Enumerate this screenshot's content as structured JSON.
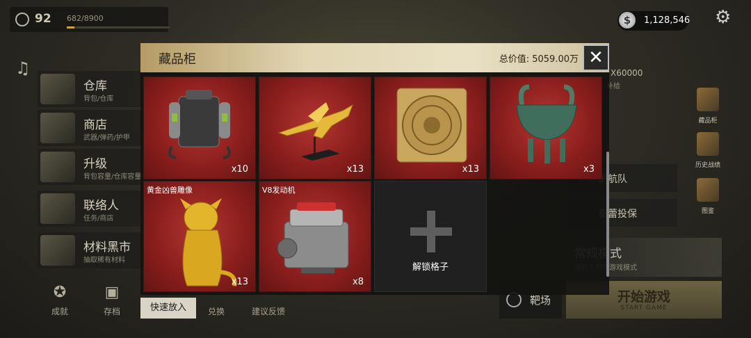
{
  "player": {
    "level": "92",
    "xp": "682/8900",
    "xp_progress": 0.077
  },
  "currency": {
    "amount": "1,128,546",
    "icon_glyph": "$"
  },
  "left_menu": [
    {
      "title": "仓库",
      "subtitle": "背包/仓库"
    },
    {
      "title": "商店",
      "subtitle": "武器/弹药/护甲"
    },
    {
      "title": "升级",
      "subtitle": "背包容量/仓库容量"
    },
    {
      "title": "联络人",
      "subtitle": "任务/商店"
    },
    {
      "title": "材料黑市",
      "subtitle": "抽取稀有材料"
    }
  ],
  "bottom_bar": [
    {
      "label": "成就",
      "icon": "medal-icon"
    },
    {
      "label": "存档",
      "icon": "save-icon"
    },
    {
      "label": "兑换",
      "icon": "exchange-icon"
    },
    {
      "label": "建议反馈",
      "icon": "feedback-icon"
    }
  ],
  "right_side_icons": [
    {
      "label": "藏品柜",
      "icon": "cabinet-icon"
    },
    {
      "label": "历史战绩",
      "icon": "history-icon"
    },
    {
      "label": "图鉴",
      "icon": "book-icon"
    }
  ],
  "right_panel": {
    "reward_amount": "X60000",
    "reward_sub": "补给",
    "btn1": "护航队",
    "btn2": "泰蕾投保",
    "mode_title": "常规模式",
    "mode_sub": "体验不同的游戏模式",
    "range_label": "靶场",
    "start_label": "开始游戏",
    "start_sub": "START GAME"
  },
  "modal": {
    "title": "藏品柜",
    "total_value": "总价值: 5059.00万",
    "quick_put": "快速放入",
    "unlock_label": "解锁格子",
    "slots": [
      {
        "name": "",
        "count": "x10",
        "icon": "jetpack-icon"
      },
      {
        "name": "",
        "count": "x13",
        "icon": "golden-jet-model-icon"
      },
      {
        "name": "",
        "count": "x13",
        "icon": "aztec-calendar-stone-icon"
      },
      {
        "name": "",
        "count": "x3",
        "icon": "bronze-ding-cauldron-icon"
      },
      {
        "name": "黄金凶兽雕像",
        "count": "x13",
        "icon": "golden-beast-statue-icon"
      },
      {
        "name": "V8发动机",
        "count": "x8",
        "icon": "v8-engine-icon"
      }
    ]
  },
  "colors": {
    "slot_red": "#8c1f1d",
    "header_gold": "#e1d5b2",
    "accent_gold": "#c9a24a"
  }
}
